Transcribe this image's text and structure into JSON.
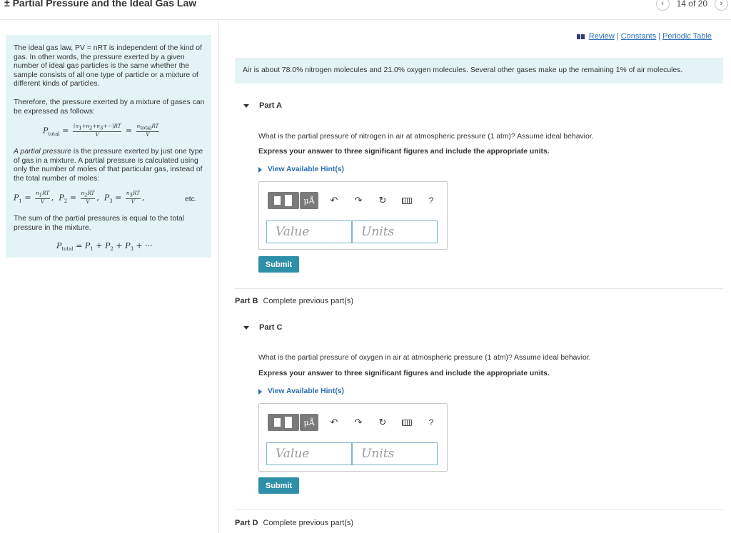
{
  "header": {
    "title": "± Partial Pressure and the Ideal Gas Law",
    "pager_text": "14 of 20",
    "prev_glyph": "‹",
    "next_glyph": "›"
  },
  "left_panel": {
    "p1": "The ideal gas law, PV = nRT is independent of the kind of gas. In other words, the pressure exerted by a given number of ideal gas particles is the same whether the sample consists of all one type of particle or a mixture of different kinds of particles.",
    "p2": "Therefore, the pressure exerted by a mixture of gases can be expressed as follows:",
    "p3_em": "A partial pressure",
    "p3_rest": " is the pressure exerted by just one type of gas in a mixture. A partial pressure is calculated using only the number of moles of that particular gas, instead of the total number of moles:",
    "etc": "etc.",
    "p4": "The sum of the partial pressures is equal to the total pressure in the mixture."
  },
  "links": {
    "review": "Review",
    "constants": "Constants",
    "periodic": "Periodic Table",
    "sep": "|"
  },
  "intro": "Air is about 78.0% nitrogen molecules and 21.0% oxygen molecules. Several other gases make up the remaining 1% of air molecules.",
  "part_a": {
    "title": "Part A",
    "question": "What is the partial pressure of nitrogen in air at atmospheric pressure (1 atm)? Assume ideal behavior.",
    "instruction": "Express your answer to three significant figures and include the appropriate units.",
    "hint": "View Available Hint(s)",
    "value_placeholder": "Value",
    "units_placeholder": "Units",
    "submit": "Submit"
  },
  "part_b": {
    "label": "Part B",
    "status": "Complete previous part(s)"
  },
  "part_c": {
    "title": "Part C",
    "question": "What is the partial pressure of oxygen in air at atmospheric pressure (1 atm)? Assume ideal behavior.",
    "instruction": "Express your answer to three significant figures and include the appropriate units.",
    "hint": "View Available Hint(s)",
    "value_placeholder": "Value",
    "units_placeholder": "Units",
    "submit": "Submit"
  },
  "part_d": {
    "label": "Part D",
    "status": "Complete previous part(s)"
  },
  "toolbar": {
    "mu_label": "μÅ",
    "undo_glyph": "↶",
    "redo_glyph": "↷",
    "reset_glyph": "↻",
    "help_glyph": "?"
  },
  "icons": [
    "template-icon",
    "units-mu-icon",
    "undo-icon",
    "redo-icon",
    "reset-icon",
    "keyboard-icon",
    "help-icon",
    "book-icon",
    "caret-down-icon",
    "caret-right-icon"
  ],
  "colors": {
    "panel_bg": "#e4f4f6",
    "link": "#2a6ebb",
    "submit_bg": "#2d8fa8",
    "field_border": "#7fb3c9"
  }
}
